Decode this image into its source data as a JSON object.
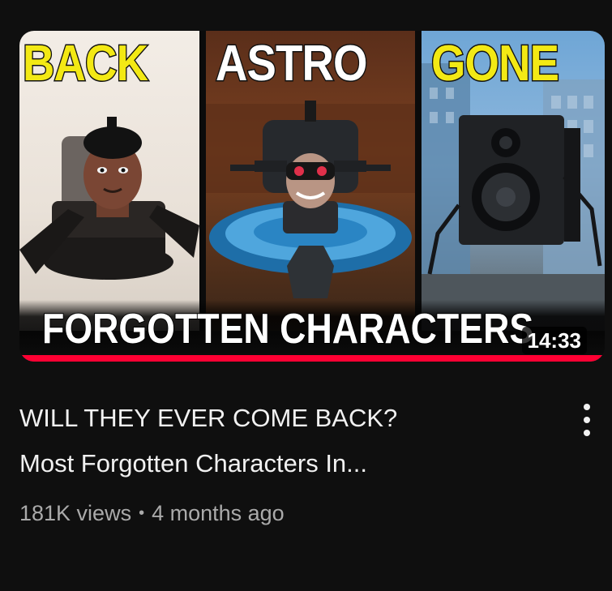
{
  "video": {
    "thumbnail": {
      "word_left": "BACK",
      "word_middle": "ASTRO",
      "word_right": "GONE",
      "banner": "FORGOTTEN CHARACTERS",
      "duration": "14:33",
      "watch_progress": 1.0,
      "accent_yellow": "#f3e914",
      "progress_color": "#ff0033"
    },
    "title_line_1": "WILL THEY EVER COME BACK?",
    "title_line_2": "Most Forgotten Characters In...",
    "views": "181K views",
    "separator": "•",
    "age": "4 months ago",
    "menu_icon": "more-vertical-icon"
  }
}
